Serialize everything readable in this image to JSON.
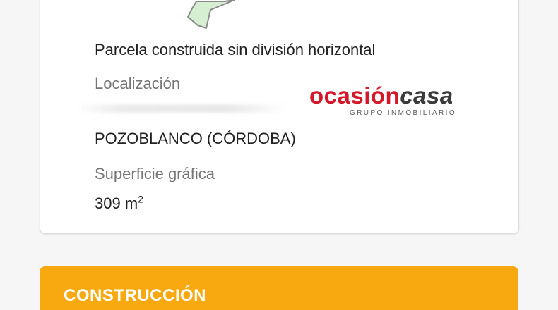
{
  "parcel_card": {
    "type_value": "Parcela construida sin división horizontal",
    "location_label": "Localización",
    "location_value": "POZOBLANCO (CÓRDOBA)",
    "surface_label": "Superficie gráfica",
    "surface_number": "309 m",
    "surface_exponent": "2"
  },
  "watermark": {
    "brand_part1": "ocasión",
    "brand_part2": "casa",
    "tagline": "GRUPO INMOBILIARIO",
    "brand_red": "#d5172a",
    "brand_dark": "#3a3a3a"
  },
  "section": {
    "title": "CONSTRUCCIÓN",
    "color": "#f7a90f"
  },
  "icons": {
    "parcel_thumbnail": "parcel-map-shape"
  }
}
